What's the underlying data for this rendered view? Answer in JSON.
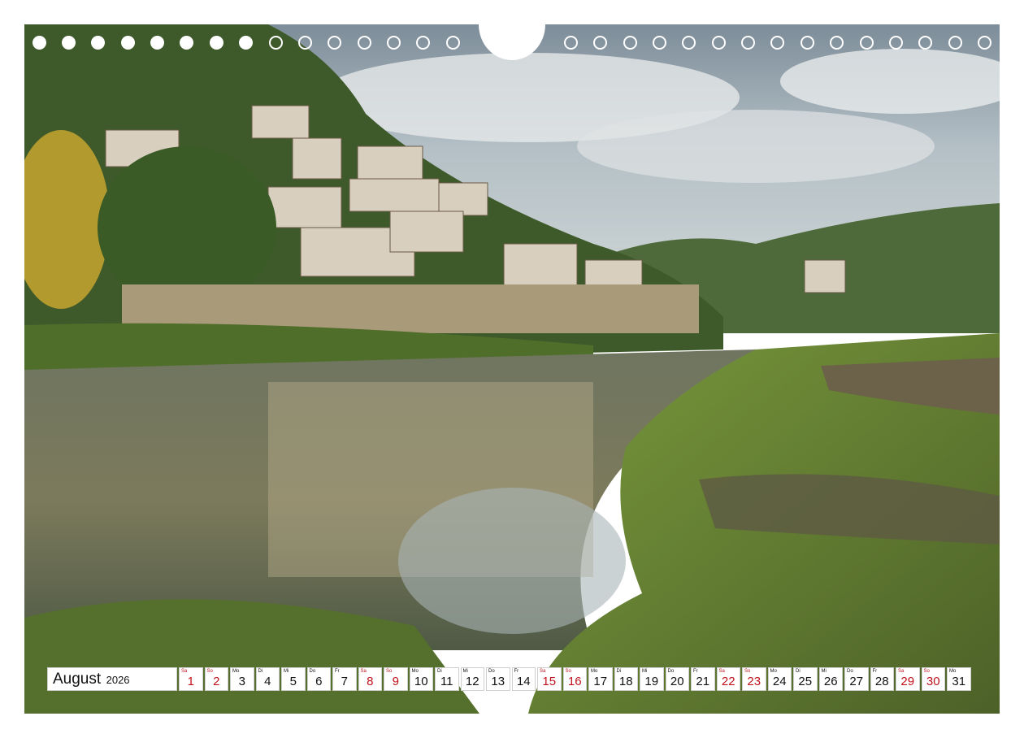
{
  "calendar": {
    "month": "August",
    "year": "2026",
    "days": [
      {
        "wd": "Sa",
        "num": "1",
        "weekend": true
      },
      {
        "wd": "So",
        "num": "2",
        "weekend": true
      },
      {
        "wd": "Mo",
        "num": "3",
        "weekend": false
      },
      {
        "wd": "Di",
        "num": "4",
        "weekend": false
      },
      {
        "wd": "Mi",
        "num": "5",
        "weekend": false
      },
      {
        "wd": "Do",
        "num": "6",
        "weekend": false
      },
      {
        "wd": "Fr",
        "num": "7",
        "weekend": false
      },
      {
        "wd": "Sa",
        "num": "8",
        "weekend": true
      },
      {
        "wd": "So",
        "num": "9",
        "weekend": true
      },
      {
        "wd": "Mo",
        "num": "10",
        "weekend": false
      },
      {
        "wd": "Di",
        "num": "11",
        "weekend": false
      },
      {
        "wd": "Mi",
        "num": "12",
        "weekend": false
      },
      {
        "wd": "Do",
        "num": "13",
        "weekend": false
      },
      {
        "wd": "Fr",
        "num": "14",
        "weekend": false
      },
      {
        "wd": "Sa",
        "num": "15",
        "weekend": true
      },
      {
        "wd": "So",
        "num": "16",
        "weekend": true
      },
      {
        "wd": "Mo",
        "num": "17",
        "weekend": false
      },
      {
        "wd": "Di",
        "num": "18",
        "weekend": false
      },
      {
        "wd": "Mi",
        "num": "19",
        "weekend": false
      },
      {
        "wd": "Do",
        "num": "20",
        "weekend": false
      },
      {
        "wd": "Fr",
        "num": "21",
        "weekend": false
      },
      {
        "wd": "Sa",
        "num": "22",
        "weekend": true
      },
      {
        "wd": "So",
        "num": "23",
        "weekend": true
      },
      {
        "wd": "Mo",
        "num": "24",
        "weekend": false
      },
      {
        "wd": "Di",
        "num": "25",
        "weekend": false
      },
      {
        "wd": "Mi",
        "num": "26",
        "weekend": false
      },
      {
        "wd": "Do",
        "num": "27",
        "weekend": false
      },
      {
        "wd": "Fr",
        "num": "28",
        "weekend": false
      },
      {
        "wd": "Sa",
        "num": "29",
        "weekend": true
      },
      {
        "wd": "So",
        "num": "30",
        "weekend": true
      },
      {
        "wd": "Mo",
        "num": "31",
        "weekend": false
      }
    ]
  },
  "colors": {
    "weekend_red": "#c0121c",
    "sky": "#8fa1ad",
    "water": "#5d6a5a",
    "grass": "#6f8f3a"
  }
}
